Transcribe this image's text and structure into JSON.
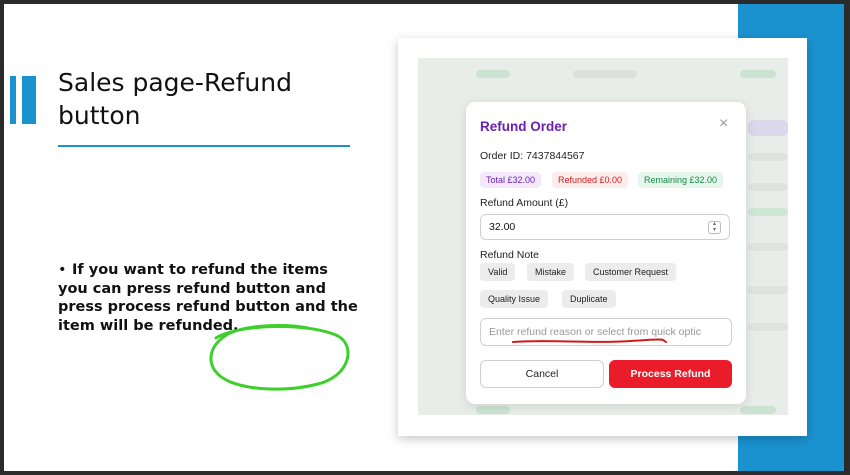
{
  "slide": {
    "title": "Sales page-Refund button",
    "bullet_marker": "•",
    "bullet_text": "If you want to refund the items you can press refund button and press process refund button and the item will be refunded."
  },
  "dialog": {
    "title": "Refund Order",
    "order_id": "Order ID: 7437844567",
    "total": "Total £32.00",
    "refunded": "Refunded £0.00",
    "remaining": "Remaining £32.00",
    "amount_label": "Refund Amount (£)",
    "amount_value": "32.00",
    "note_label": "Refund Note",
    "quick_options": [
      "Valid",
      "Mistake",
      "Customer Request",
      "Quality Issue",
      "Duplicate"
    ],
    "note_placeholder": "Enter refund reason or select from quick optic",
    "cancel_label": "Cancel",
    "process_label": "Process Refund",
    "close_glyph": "×",
    "stepper_up_glyph": "▴",
    "stepper_down_glyph": "▾"
  },
  "icons": {
    "close": "close-icon",
    "stepper": "number-stepper-icon"
  },
  "colors": {
    "accent_blue": "#1b92d0",
    "dialog_title": "#6a1fb0",
    "process_button": "#ea1c2a",
    "annotation_green": "#3dcf2a",
    "annotation_red": "#d11a1a"
  }
}
